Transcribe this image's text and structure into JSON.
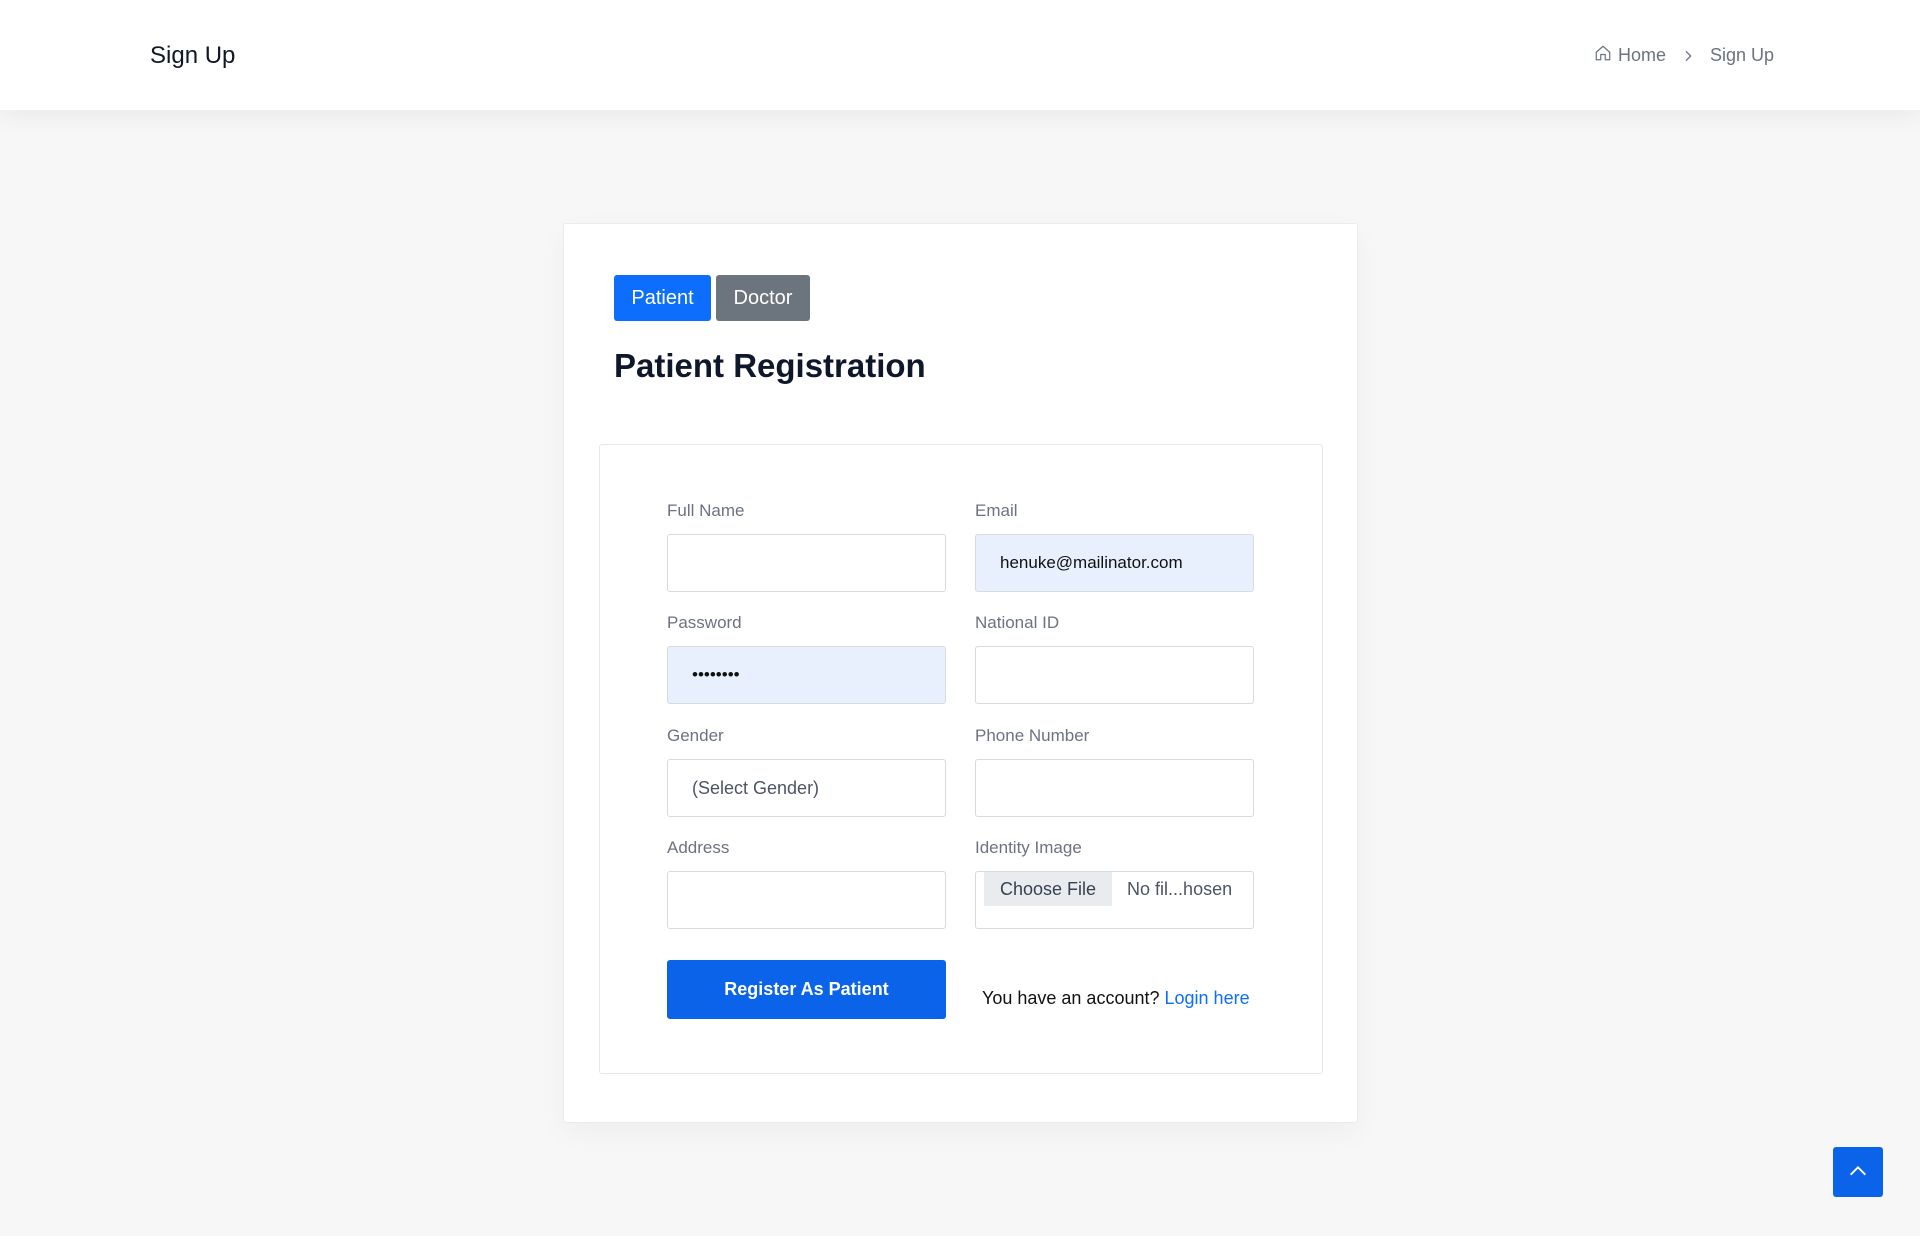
{
  "header": {
    "title": "Sign Up",
    "breadcrumb": {
      "home": "Home",
      "current": "Sign Up"
    }
  },
  "card": {
    "tabs": {
      "patient": "Patient",
      "doctor": "Doctor"
    },
    "heading": "Patient Registration"
  },
  "form": {
    "full_name": {
      "label": "Full Name",
      "value": ""
    },
    "email": {
      "label": "Email",
      "value": "henuke@mailinator.com"
    },
    "password": {
      "label": "Password",
      "value": "••••••••"
    },
    "national_id": {
      "label": "National ID",
      "value": ""
    },
    "gender": {
      "label": "Gender",
      "value": "(Select Gender)"
    },
    "phone": {
      "label": "Phone Number",
      "value": ""
    },
    "address": {
      "label": "Address",
      "value": ""
    },
    "identity_image": {
      "label": "Identity Image",
      "button": "Choose File",
      "status": "No fil...hosen"
    },
    "submit_label": "Register As Patient",
    "account_prompt": "You have an account?",
    "login_link": "Login here"
  },
  "colors": {
    "primary": "#0d6efd",
    "secondary": "#6c757d",
    "autofill": "#e8f0fe"
  },
  "icons": {
    "home": "home-icon",
    "separator": "chevron-right-icon",
    "scroll_top": "chevron-up-icon"
  }
}
